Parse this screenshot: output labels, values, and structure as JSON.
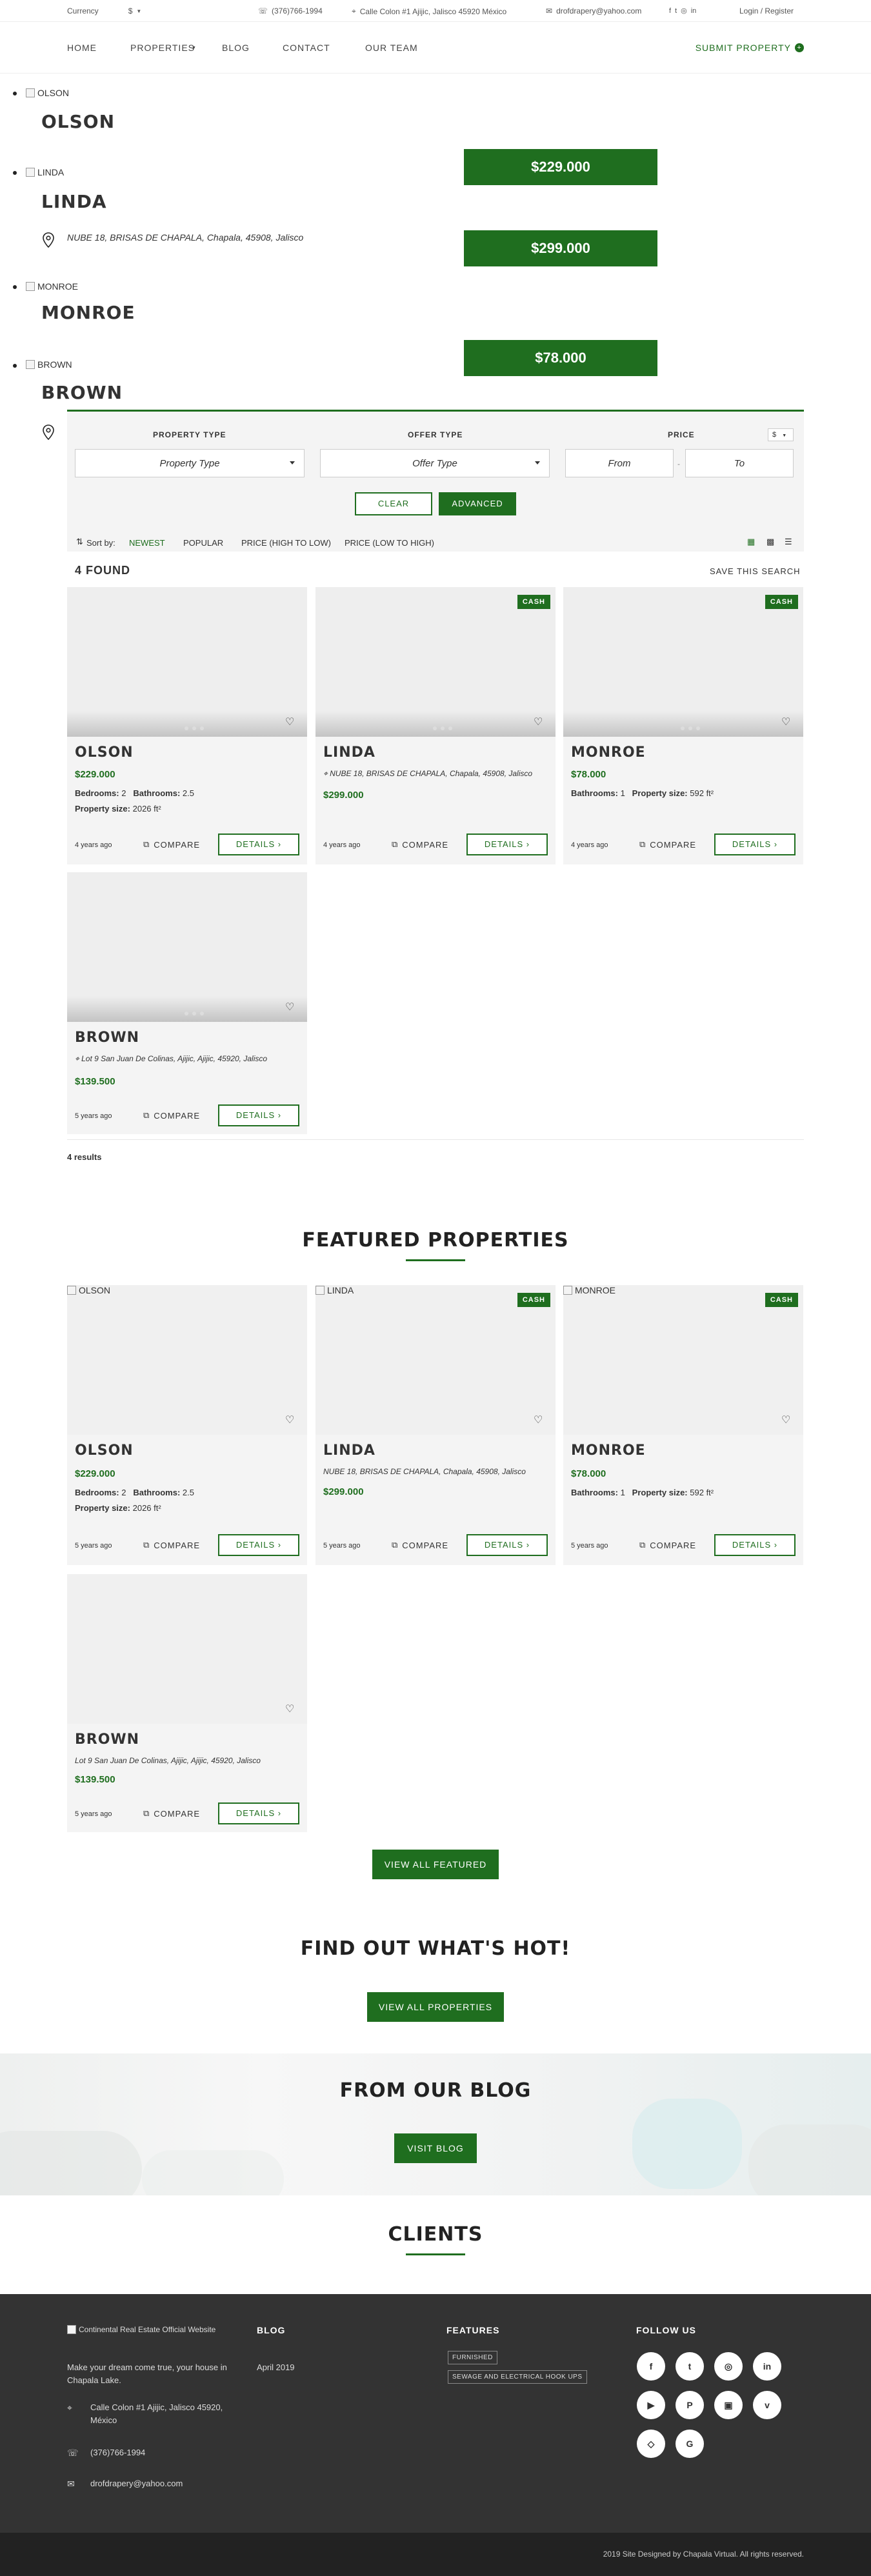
{
  "topbar": {
    "currency_label": "Currency",
    "currency_value": "$",
    "phone": "(376)766-1994",
    "address": "Calle Colon #1 Ajijic, Jalisco 45920 México",
    "email": "drofdrapery@yahoo.com",
    "login": "Login / Register"
  },
  "nav": {
    "home": "HOME",
    "properties": "PROPERTIES",
    "blog": "BLOG",
    "contact": "CONTACT",
    "team": "OUR TEAM",
    "submit": "SUBMIT PROPERTY"
  },
  "slider": [
    {
      "alt": "OLSON",
      "title": "OLSON",
      "price": "",
      "address": ""
    },
    {
      "alt": "LINDA",
      "title": "LINDA",
      "price": "$229.000",
      "address": "NUBE 18, BRISAS DE CHAPALA, Chapala, 45908, Jalisco"
    },
    {
      "alt": "MONROE",
      "title": "MONROE",
      "price": "$299.000",
      "address": ""
    },
    {
      "alt": "BROWN",
      "title": "BROWN",
      "price": "$78.000",
      "address": ""
    }
  ],
  "search": {
    "property_type_label": "PROPERTY TYPE",
    "property_type_value": "Property Type",
    "offer_type_label": "OFFER TYPE",
    "offer_type_value": "Offer Type",
    "price_label": "PRICE",
    "currency": "$",
    "from": "From",
    "to": "To",
    "dash": "-",
    "clear": "CLEAR",
    "advanced": "ADVANCED"
  },
  "sort": {
    "label": "Sort by:",
    "newest": "NEWEST",
    "popular": "POPULAR",
    "price_high": "PRICE (HIGH TO LOW)",
    "price_low": "PRICE (LOW TO HIGH)"
  },
  "results": {
    "found": "4 FOUND",
    "save": "SAVE THIS SEARCH",
    "count": "4 results"
  },
  "listings": [
    {
      "title": "OLSON",
      "badge": "",
      "address": "",
      "price": "$229.000",
      "bedrooms": "2",
      "bathrooms": "2.5",
      "size": "2026 ft²",
      "age": "4 years ago"
    },
    {
      "title": "LINDA",
      "badge": "CASH",
      "address": "NUBE 18, BRISAS DE CHAPALA, Chapala, 45908, Jalisco",
      "price": "$299.000",
      "age": "4 years ago"
    },
    {
      "title": "MONROE",
      "badge": "CASH",
      "address": "",
      "price": "$78.000",
      "bathrooms": "1",
      "size": "592 ft²",
      "age": "4 years ago"
    },
    {
      "title": "BROWN",
      "badge": "",
      "address": "Lot 9 San Juan De Colinas, Ajijic, Ajijic, 45920, Jalisco",
      "price": "$139.500",
      "age": "5 years ago"
    }
  ],
  "labels": {
    "bedrooms": "Bedrooms:",
    "bathrooms": "Bathrooms:",
    "size": "Property size:",
    "compare": "COMPARE",
    "details": "DETAILS"
  },
  "featured": {
    "title": "FEATURED PROPERTIES",
    "items": [
      {
        "alt": "OLSON",
        "title": "OLSON",
        "badge": "",
        "address": "",
        "price": "$229.000",
        "bedrooms": "2",
        "bathrooms": "2.5",
        "size": "2026 ft²",
        "age": "5 years ago"
      },
      {
        "alt": "LINDA",
        "title": "LINDA",
        "badge": "CASH",
        "address": "NUBE 18, BRISAS DE CHAPALA, Chapala, 45908, Jalisco",
        "price": "$299.000",
        "age": "5 years ago"
      },
      {
        "alt": "MONROE",
        "title": "MONROE",
        "badge": "CASH",
        "address": "",
        "price": "$78.000",
        "bathrooms": "1",
        "size": "592 ft²",
        "age": "5 years ago"
      },
      {
        "alt": "",
        "title": "BROWN",
        "badge": "",
        "address": "Lot 9 San Juan De Colinas, Ajijic, Ajijic, 45920, Jalisco",
        "price": "$139.500",
        "age": "5 years ago"
      }
    ],
    "view_all": "VIEW ALL FEATURED"
  },
  "hot": {
    "title": "FIND OUT WHAT'S HOT!",
    "button": "VIEW ALL PROPERTIES"
  },
  "blog": {
    "title": "FROM OUR BLOG",
    "button": "VISIT BLOG"
  },
  "clients": {
    "title": "CLIENTS"
  },
  "footer": {
    "logo_alt": "Continental Real Estate Official Website",
    "tagline": "Make your dream come true, your house in Chapala Lake.",
    "address": "Calle Colon #1 Ajijic, Jalisco 45920, México",
    "phone": "(376)766-1994",
    "email": "drofdrapery@yahoo.com",
    "blog_heading": "BLOG",
    "blog_item": "April 2019",
    "features_heading": "FEATURES",
    "feature_1": "FURNISHED",
    "feature_2": "SEWAGE AND ELECTRICAL HOOK UPS",
    "follow_heading": "FOLLOW US",
    "social": [
      "f",
      "t",
      "ig",
      "in",
      "yt",
      "p",
      "ig2",
      "v",
      "db",
      "G"
    ],
    "copyright": "2019 Site Designed by Chapala Virtual. All rights reserved."
  },
  "colors": {
    "accent": "#1f6e1f",
    "footer": "#333333",
    "footer_bottom": "#222222"
  }
}
